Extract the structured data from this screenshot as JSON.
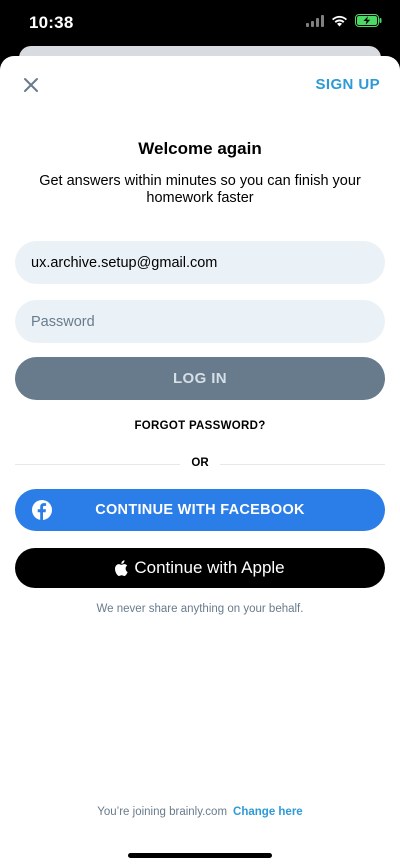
{
  "status_bar": {
    "time": "10:38"
  },
  "header": {
    "close_icon": "close-icon",
    "signup_label": "SIGN UP"
  },
  "main": {
    "title": "Welcome again",
    "subtitle": "Get answers within minutes so you can finish your homework faster",
    "email_value": "ux.archive.setup@gmail.com",
    "password_placeholder": "Password",
    "login_label": "LOG IN",
    "forgot_label": "FORGOT PASSWORD?",
    "or_label": "OR",
    "facebook_label": "CONTINUE WITH FACEBOOK",
    "apple_label": "Continue with Apple",
    "privacy_note": "We never share anything on your behalf."
  },
  "footer": {
    "joining_text": "You’re joining brainly.com",
    "change_label": "Change here"
  },
  "colors": {
    "accent": "#2d9ad7",
    "facebook": "#2b7de8",
    "login_disabled": "#687b8c",
    "field_bg": "#ebf2f7"
  }
}
